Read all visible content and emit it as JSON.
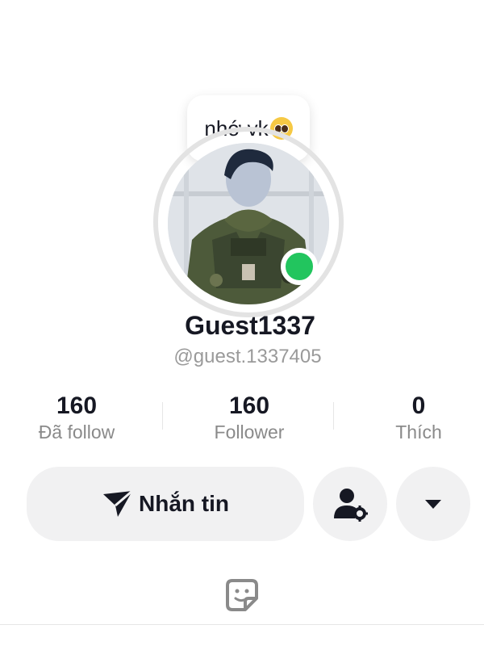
{
  "status_bubble": {
    "text": "nhớ vk",
    "emoji": "pleading-face-emoji"
  },
  "profile": {
    "display_name": "Guest1337",
    "username": "@guest.1337405",
    "online": true
  },
  "stats": [
    {
      "value": "160",
      "label": "Đã follow"
    },
    {
      "value": "160",
      "label": "Follower"
    },
    {
      "value": "0",
      "label": "Thích"
    }
  ],
  "actions": {
    "message_label": "Nhắn tin",
    "message_icon": "send-icon",
    "friend_icon": "user-settings-icon",
    "more_icon": "caret-down-icon"
  },
  "tabs": {
    "icon": "sticker-icon"
  },
  "colors": {
    "online": "#22c55e",
    "button_bg": "#f1f1f2",
    "muted_text": "#8a8a8a"
  }
}
